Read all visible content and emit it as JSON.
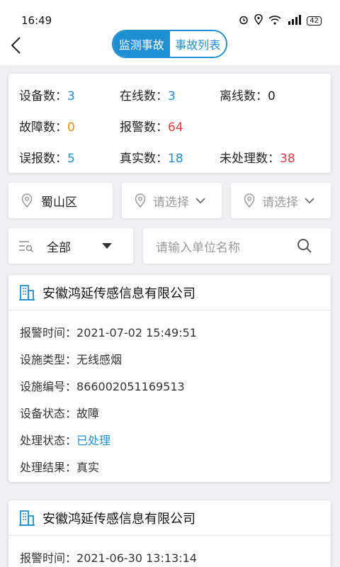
{
  "status_bar": {
    "time": "16:49",
    "battery": "42"
  },
  "header": {
    "tabs": [
      {
        "label": "监测事故",
        "active": true
      },
      {
        "label": "事故列表",
        "active": false
      }
    ]
  },
  "stats": [
    {
      "label": "设备数：",
      "value": "3",
      "color": "#1e8fd0"
    },
    {
      "label": "在线数：",
      "value": "3",
      "color": "#1e8fd0"
    },
    {
      "label": "离线数：",
      "value": "0",
      "color": "#222222"
    },
    {
      "label": "故障数：",
      "value": "0",
      "color": "#f08c00"
    },
    {
      "label": "报警数：",
      "value": "64",
      "color": "#e83a3a"
    },
    {
      "label": "误报数：",
      "value": "5",
      "color": "#1e8fd0"
    },
    {
      "label": "真实数：",
      "value": "18",
      "color": "#1e8fd0"
    },
    {
      "label": "未处理数：",
      "value": "38",
      "color": "#e83a3a"
    }
  ],
  "filters": {
    "district": "蜀山区",
    "select_placeholder_1": "请选择",
    "select_placeholder_2": "请选择",
    "category": "全部",
    "search_placeholder": "请输入单位名称"
  },
  "records": [
    {
      "company": "安徽鸿延传感信息有限公司",
      "fields": [
        {
          "label": "报警时间：",
          "value": "2021-07-02 15:49:51"
        },
        {
          "label": "设施类型：",
          "value": "无线感烟"
        },
        {
          "label": "设施编号：",
          "value": "866002051169513"
        },
        {
          "label": "设备状态：",
          "value": "故障"
        },
        {
          "label": "处理状态：",
          "value": "已处理"
        },
        {
          "label": "处理结果：",
          "value": "真实"
        }
      ]
    },
    {
      "company": "安徽鸿延传感信息有限公司",
      "fields": [
        {
          "label": "报警时间：",
          "value": "2021-06-30 13:13:14"
        }
      ]
    }
  ],
  "colors": {
    "accent": "#1e8fd0",
    "warning": "#f08c00",
    "danger": "#e83a3a"
  }
}
